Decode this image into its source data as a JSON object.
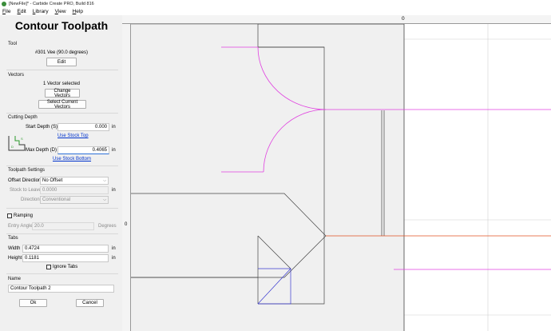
{
  "window": {
    "title": "[NewFile]* - Carbide Create PRO, Build 816"
  },
  "menu": [
    "File",
    "Edit",
    "Library",
    "View",
    "Help"
  ],
  "panel": {
    "title": "Contour Toolpath",
    "tool": {
      "label": "Tool",
      "name": "#301 Vee (90.0 degrees)",
      "edit": "Edit"
    },
    "vectors": {
      "label": "Vectors",
      "status": "1 Vector selected",
      "change": "Change Vectors",
      "select_current": "Select Current Vectors"
    },
    "cutting_depth": {
      "label": "Cutting Depth",
      "start_label": "Start Depth (S)",
      "start_value": "0.000",
      "start_unit": "in",
      "use_stock_top": "Use Stock Top",
      "max_label": "Max Depth (D)",
      "max_value": "0.4065",
      "max_unit": "in",
      "use_stock_bottom": "Use Stock Bottom"
    },
    "toolpath_settings": {
      "label": "Toolpath Settings",
      "offset_label": "Offset Direction",
      "offset_value": "No Offset",
      "stock_label": "Stock to Leave",
      "stock_value": "0.0000",
      "stock_unit": "in",
      "direction_label": "Direction",
      "direction_value": "Conventional"
    },
    "ramping": {
      "label": "Ramping",
      "entry_label": "Entry Angle",
      "entry_value": "20.0",
      "entry_unit": "Degrees"
    },
    "tabs": {
      "label": "Tabs",
      "width_label": "Width",
      "width_value": "0.4724",
      "width_unit": "in",
      "height_label": "Height",
      "height_value": "0.1181",
      "height_unit": "in",
      "ignore_label": "Ignore Tabs"
    },
    "name": {
      "label": "Name",
      "value": "Contour Toolpath 2"
    },
    "ok": "Ok",
    "cancel": "Cancel"
  },
  "canvas": {
    "ruler_zero_top": "0",
    "ruler_zero_left": "0",
    "colors": {
      "stock": "#f0f0f0",
      "vector": "#444444",
      "toolpath": "#e040e0",
      "selected": "#3a3ad0",
      "origin": "#e05020",
      "edge_mark": "#c03030"
    }
  }
}
